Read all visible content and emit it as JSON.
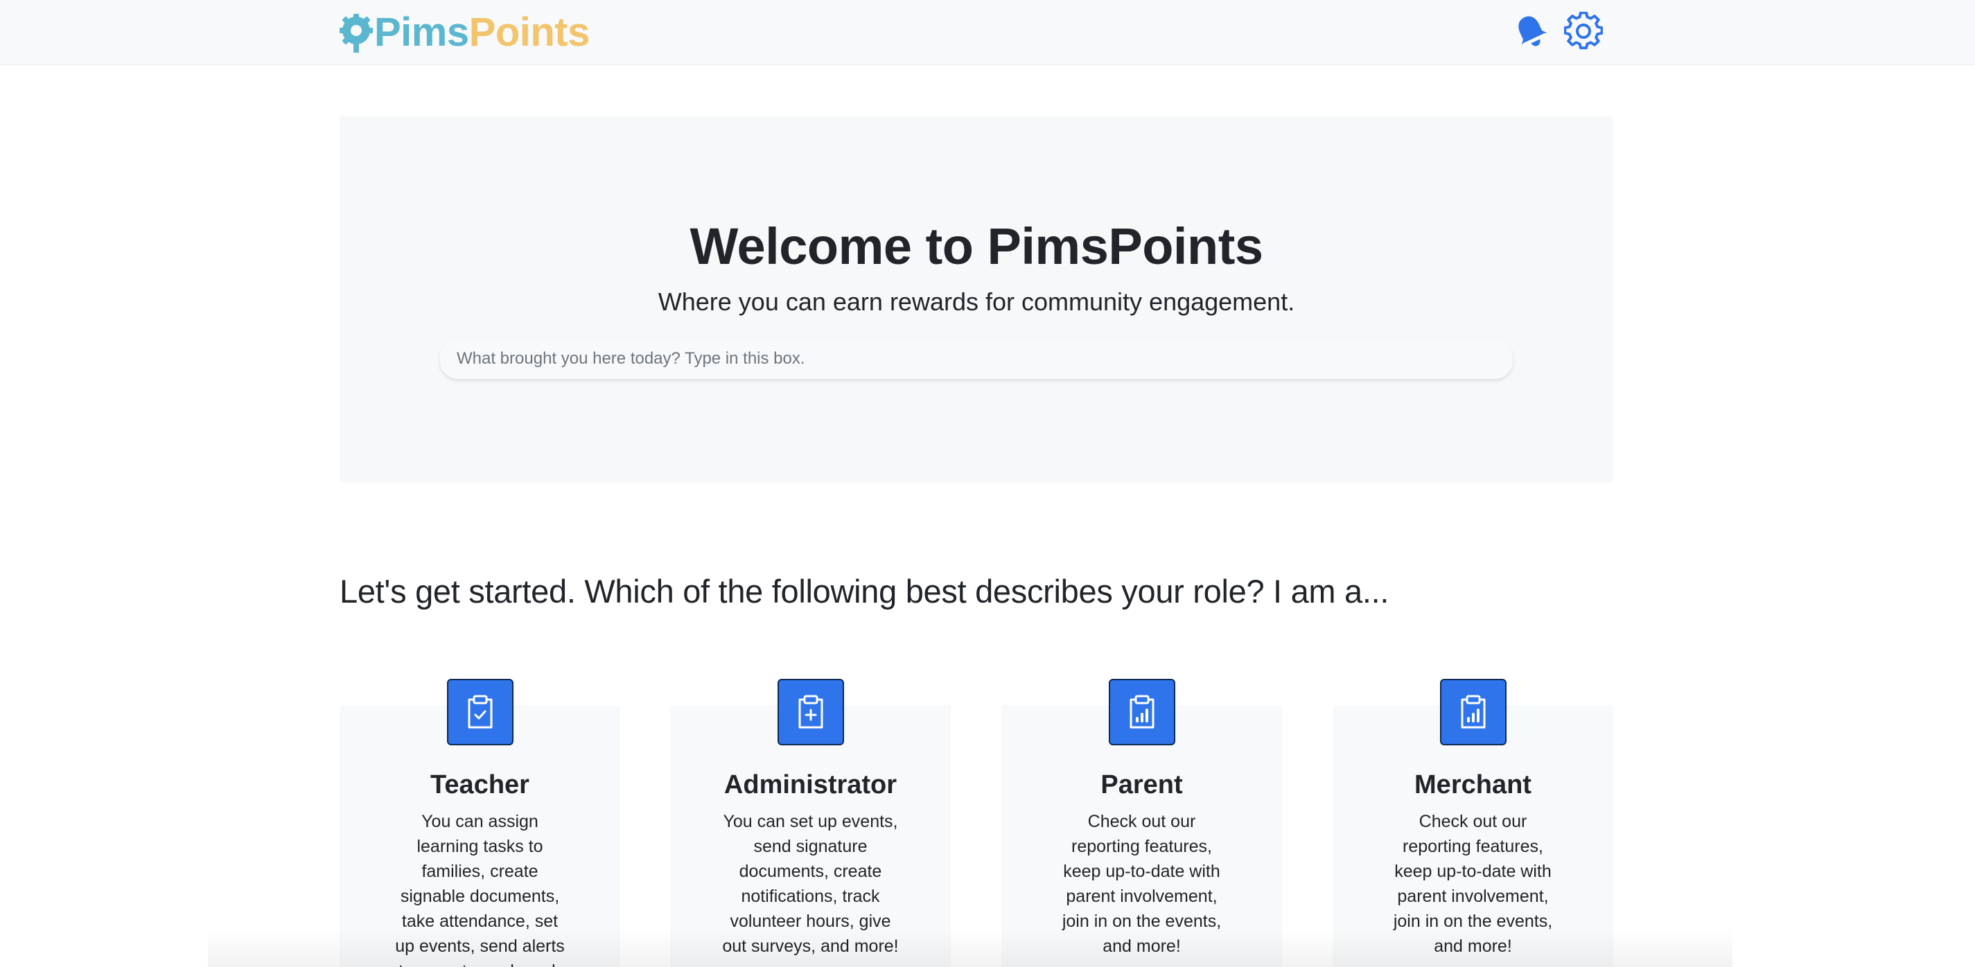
{
  "navbar": {
    "logo_part1": "Pims",
    "logo_part2": "Points",
    "icons": [
      "bell-icon",
      "gear-icon"
    ],
    "colors": {
      "logo_pims": "#5bb7cf",
      "logo_points": "#f2c46b",
      "icon_blue": "#2f74ea"
    }
  },
  "hero": {
    "title": "Welcome to PimsPoints",
    "subtitle": "Where you can earn rewards for community engagement.",
    "search": {
      "placeholder": "What brought you here today? Type in this box.",
      "value": ""
    }
  },
  "roles": {
    "heading": "Let's get started. Which of the following best describes your role? I am a...",
    "cards": [
      {
        "title": "Teacher",
        "icon": "clipboard-check-icon",
        "description": "You can assign learning tasks to families, create signable documents, take attendance, set up events, send alerts to parents, and much"
      },
      {
        "title": "Administrator",
        "icon": "clipboard-plus-icon",
        "description": "You can set up events, send signature documents, create notifications, track volunteer hours, give out surveys, and more!"
      },
      {
        "title": "Parent",
        "icon": "clipboard-data-icon",
        "description": "Check out our reporting features, keep up-to-date with parent involvement, join in on the events, and more!"
      },
      {
        "title": "Merchant",
        "icon": "clipboard-data-icon",
        "description": "Check out our reporting features, keep up-to-date with parent involvement, join in on the events, and more!"
      }
    ],
    "card_icon_color": "#2f74ea"
  }
}
